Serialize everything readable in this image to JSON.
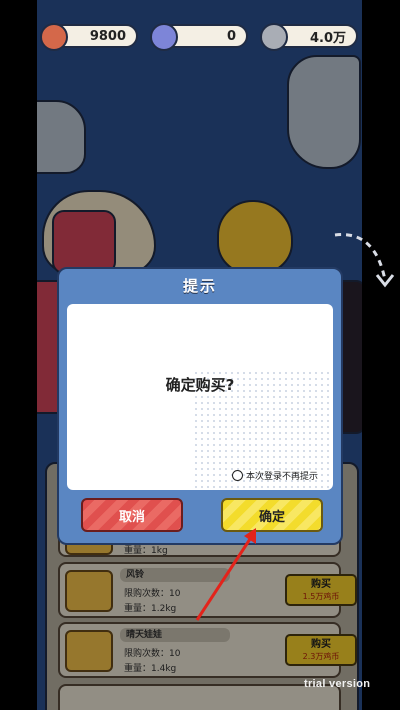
{
  "top_bar": {
    "currency_1": {
      "value": "9800",
      "icon": "copper-coin-icon",
      "color": "#d4684a"
    },
    "currency_2": {
      "value": "0",
      "icon": "gem-icon",
      "color": "#7d85d8"
    },
    "currency_3": {
      "value": "4.0万",
      "icon": "silver-coin-icon",
      "color": "#a9adb5"
    }
  },
  "dialog": {
    "title": "提示",
    "message": "确定购买?",
    "checkbox_label": "本次登录不再提示",
    "cancel_label": "取消",
    "confirm_label": "确定"
  },
  "list": {
    "items": [
      {
        "name": "",
        "limit": "",
        "weight": "重量：1kg",
        "buy_label": "",
        "price": ""
      },
      {
        "name": "风铃",
        "limit": "限购次数：10",
        "weight": "重量：1.2kg",
        "buy_label": "购买",
        "price": "1.5万鸡币"
      },
      {
        "name": "晴天娃娃",
        "limit": "限购次数：10",
        "weight": "重量：1.4kg",
        "buy_label": "购买",
        "price": "2.3万鸡币"
      },
      {
        "name": "",
        "limit": "",
        "weight": "",
        "buy_label": "",
        "price": ""
      }
    ]
  },
  "watermark": "trial version",
  "colors": {
    "background": "#2a4f8f",
    "dialog": "#5a86c2",
    "cancel": "#e0504e",
    "confirm": "#f3dc2c",
    "arrow": "#e3231b"
  }
}
